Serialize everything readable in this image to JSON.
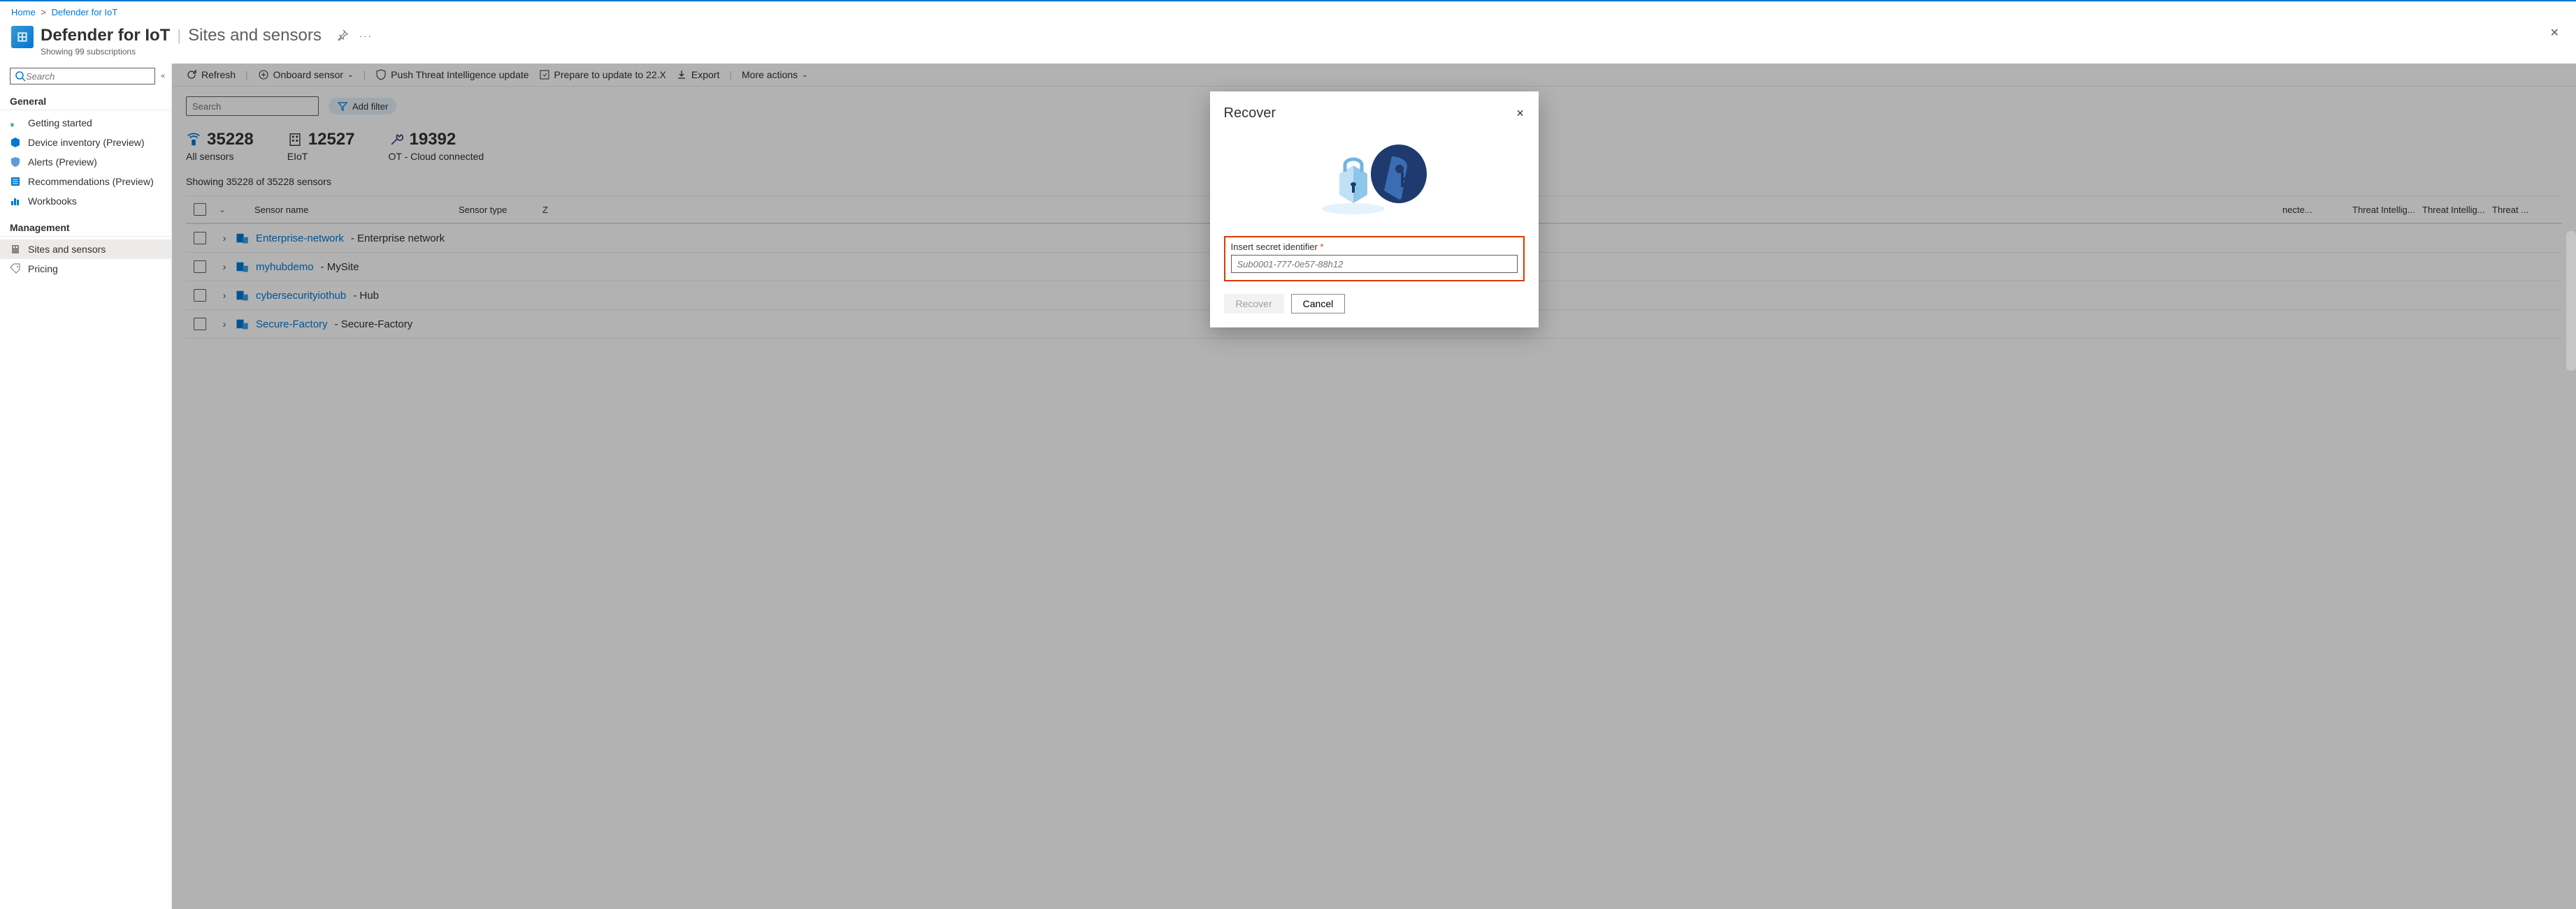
{
  "breadcrumb": {
    "home": "Home",
    "current": "Defender for IoT"
  },
  "header": {
    "title": "Defender for IoT",
    "section": "Sites and sensors",
    "subtitle": "Showing 99 subscriptions"
  },
  "sidebar": {
    "search_placeholder": "Search",
    "sections": {
      "general": {
        "label": "General",
        "items": [
          {
            "icon": "rocket",
            "label": "Getting started"
          },
          {
            "icon": "cube",
            "label": "Device inventory (Preview)"
          },
          {
            "icon": "shield",
            "label": "Alerts (Preview)"
          },
          {
            "icon": "list",
            "label": "Recommendations (Preview)"
          },
          {
            "icon": "chart",
            "label": "Workbooks"
          }
        ]
      },
      "management": {
        "label": "Management",
        "items": [
          {
            "icon": "building",
            "label": "Sites and sensors",
            "active": true
          },
          {
            "icon": "tag",
            "label": "Pricing"
          }
        ]
      }
    }
  },
  "toolbar": {
    "refresh": "Refresh",
    "onboard": "Onboard sensor",
    "push_ti": "Push Threat Intelligence update",
    "prepare": "Prepare to update to 22.X",
    "export": "Export",
    "more": "More actions"
  },
  "content": {
    "search_placeholder": "Search",
    "add_filter": "Add filter",
    "stats": [
      {
        "value": "35228",
        "label": "All sensors"
      },
      {
        "value": "12527",
        "label": "EIoT"
      },
      {
        "value": "19392",
        "label": "OT - Cloud connected"
      }
    ],
    "showing": "Showing 35228 of 35228 sensors",
    "columns": {
      "name": "Sensor name",
      "type": "Sensor type",
      "zone": "Z",
      "c1": "necte...",
      "c2": "Threat Intellig...",
      "c3": "Threat Intellig...",
      "c4": "Threat ..."
    },
    "rows": [
      {
        "link": "Enterprise-network",
        "desc": "Enterprise network"
      },
      {
        "link": "myhubdemo",
        "desc": "MySite"
      },
      {
        "link": "cybersecurityiothub",
        "desc": "Hub"
      },
      {
        "link": "Secure-Factory",
        "desc": "Secure-Factory"
      }
    ]
  },
  "dialog": {
    "title": "Recover",
    "field_label": "Insert secret identifier",
    "field_placeholder": "Sub0001-777-0e57-88h12",
    "recover_btn": "Recover",
    "cancel_btn": "Cancel"
  }
}
